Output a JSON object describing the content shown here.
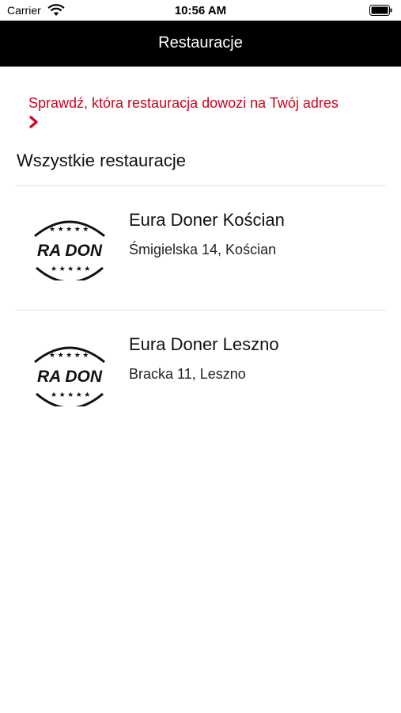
{
  "status_bar": {
    "carrier": "Carrier",
    "time": "10:56 AM"
  },
  "nav": {
    "title": "Restauracje"
  },
  "delivery_link": {
    "label": "Sprawdź, która restauracja dowozi na Twój adres",
    "color": "#d0021b"
  },
  "section": {
    "title": "Wszystkie restauracje"
  },
  "restaurants": [
    {
      "name": "Eura Doner Kościan",
      "address": "Śmigielska 14, Kościan",
      "logo_text": "RA DON"
    },
    {
      "name": "Eura Doner Leszno",
      "address": "Bracka 11, Leszno",
      "logo_text": "RA DON"
    }
  ],
  "icons": [
    "wifi-icon",
    "battery-icon",
    "chevron-right-icon",
    "restaurant-logo"
  ]
}
